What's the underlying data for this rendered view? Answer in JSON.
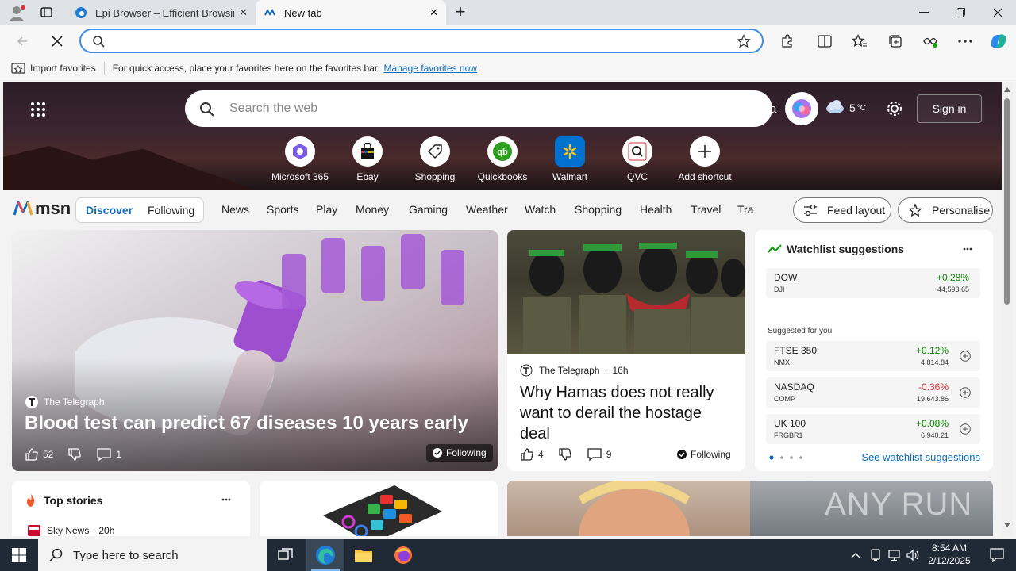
{
  "browser": {
    "tabs": [
      {
        "title": "Epi Browser – Efficient Browsing,",
        "active": false
      },
      {
        "title": "New tab",
        "active": true
      }
    ],
    "address_value": "",
    "favorites_bar": {
      "import_label": "Import favorites",
      "hint": "For quick access, place your favorites here on the favorites bar.",
      "manage_link": "Manage favorites now"
    }
  },
  "msn": {
    "search_placeholder": "Search the web",
    "weather_temp": "5",
    "weather_unit": "°C",
    "sign_in": "Sign in",
    "overlap_text": "ra",
    "shortcuts": [
      "Microsoft 365",
      "Ebay",
      "Shopping",
      "Quickbooks",
      "Walmart",
      "QVC",
      "Add shortcut"
    ],
    "logo_text": "msn",
    "feed_tabs": [
      "Discover",
      "Following"
    ],
    "nav": [
      "News",
      "Sports",
      "Play",
      "Money",
      "Gaming",
      "Weather",
      "Watch",
      "Shopping",
      "Health",
      "Travel",
      "Tra"
    ],
    "feed_layout": "Feed layout",
    "personalise": "Personalise"
  },
  "hero_article": {
    "source": "The Telegraph",
    "headline": "Blood test can predict 67 diseases 10 years early",
    "likes": "52",
    "comments": "1",
    "following": "Following"
  },
  "second_article": {
    "source": "The Telegraph",
    "age": "16h",
    "headline": "Why Hamas does not really want to derail the hostage deal",
    "likes": "4",
    "comments": "9",
    "following": "Following"
  },
  "watchlist": {
    "title": "Watchlist suggestions",
    "main": {
      "name": "DOW",
      "sub": "DJI",
      "change": "+0.28%",
      "value": "44,593.65"
    },
    "suggested_label": "Suggested for you",
    "suggested": [
      {
        "name": "FTSE 350",
        "sub": "NMX",
        "change": "+0.12%",
        "value": "4,814.84"
      },
      {
        "name": "NASDAQ",
        "sub": "COMP",
        "change": "-0.36%",
        "value": "19,643.86"
      },
      {
        "name": "UK 100",
        "sub": "FRGBR1",
        "change": "+0.08%",
        "value": "6,940.21"
      }
    ],
    "see_more": "See watchlist suggestions"
  },
  "top_stories": {
    "title": "Top stories",
    "first_source": "Sky News",
    "first_age": "20h"
  },
  "watermark": "ANY RUN",
  "taskbar": {
    "search_placeholder": "Type here to search",
    "time": "8:54 AM",
    "date": "2/12/2025"
  },
  "colors": {
    "accent": "#0f6cbd",
    "positive": "#0b8a00",
    "negative": "#d13438",
    "taskbar": "#1f2a36"
  }
}
